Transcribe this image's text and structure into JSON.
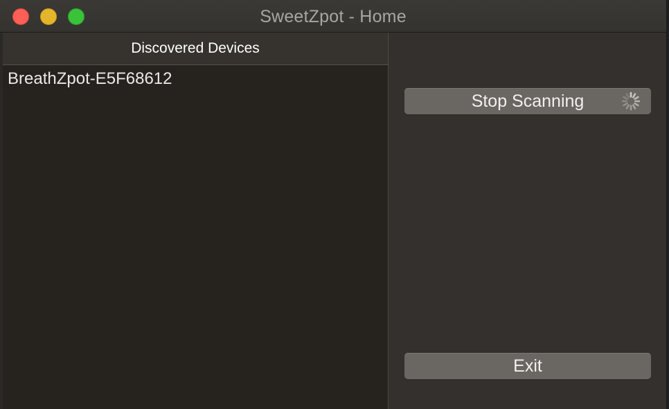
{
  "window": {
    "title": "SweetZpot - Home"
  },
  "devices": {
    "header": "Discovered Devices",
    "items": [
      {
        "name": "BreathZpot-E5F68612"
      }
    ]
  },
  "actions": {
    "stop_scanning_label": "Stop Scanning",
    "exit_label": "Exit",
    "scanning_indicator_icon": "spinner-icon"
  },
  "colors": {
    "close": "#fe5f57",
    "minimize": "#e3b52a",
    "maximize": "#39c23a"
  }
}
